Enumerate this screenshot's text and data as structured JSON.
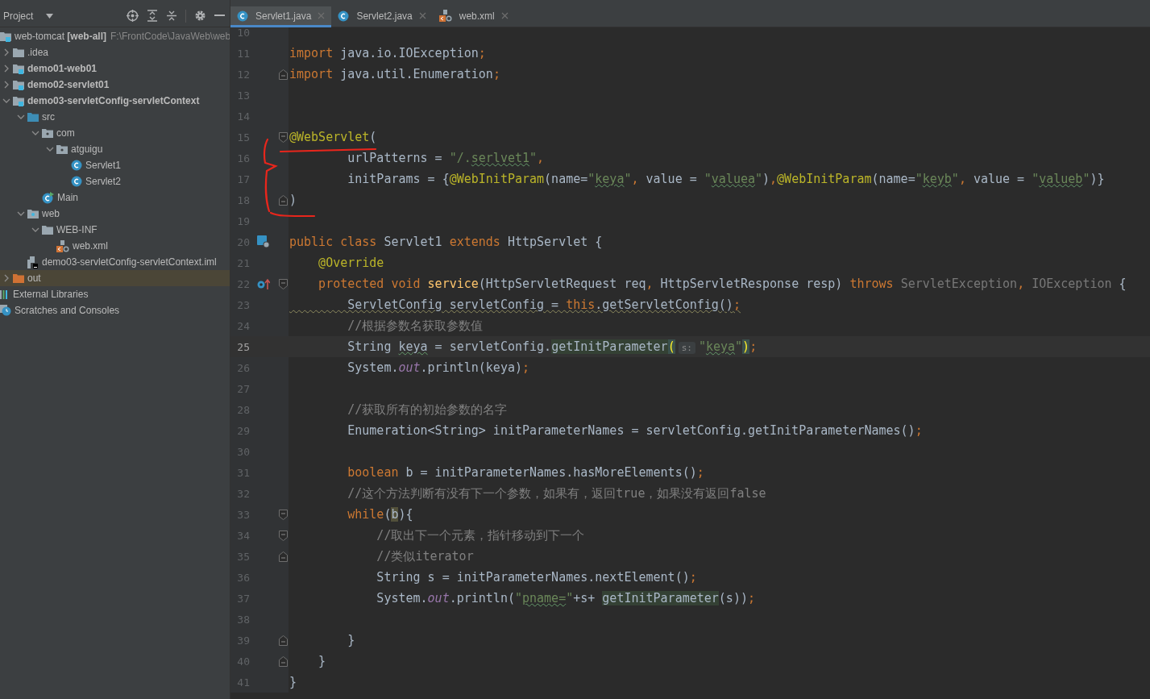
{
  "sidebar": {
    "title": "Project",
    "tree": [
      {
        "label": "web-tomcat **[web-all]**",
        "path": "F:\\FrontCode\\JavaWeb\\web",
        "kind": "project",
        "selected": false,
        "children": [
          {
            "label": ".idea",
            "kind": "folder",
            "expanded": false,
            "selected": false
          },
          {
            "label": "demo01-web01",
            "kind": "module",
            "expanded": false,
            "selected": false
          },
          {
            "label": "demo02-servlet01",
            "kind": "module",
            "expanded": false,
            "selected": false
          },
          {
            "label": "demo03-servletConfig-servletContext",
            "kind": "module",
            "expanded": true,
            "selected": false,
            "children": [
              {
                "label": "src",
                "kind": "source",
                "expanded": true,
                "selected": false,
                "children": [
                  {
                    "label": "com",
                    "kind": "package",
                    "expanded": true,
                    "selected": false,
                    "children": [
                      {
                        "label": "atguigu",
                        "kind": "package",
                        "expanded": true,
                        "selected": false,
                        "children": [
                          {
                            "label": "Servlet1",
                            "kind": "class",
                            "selected": false
                          },
                          {
                            "label": "Servlet2",
                            "kind": "class",
                            "selected": false
                          }
                        ]
                      }
                    ]
                  },
                  {
                    "label": "Main",
                    "kind": "main",
                    "selected": false
                  }
                ]
              },
              {
                "label": "web",
                "kind": "web",
                "expanded": true,
                "selected": false,
                "children": [
                  {
                    "label": "WEB-INF",
                    "kind": "folder",
                    "expanded": true,
                    "selected": false,
                    "children": [
                      {
                        "label": "web.xml",
                        "kind": "xml",
                        "selected": false
                      }
                    ]
                  }
                ]
              },
              {
                "label": "demo03-servletConfig-servletContext.iml",
                "kind": "iml",
                "selected": false
              }
            ]
          },
          {
            "label": "out",
            "kind": "excluded",
            "expanded": false,
            "selected": true
          }
        ]
      },
      {
        "label": "External Libraries",
        "kind": "libraries",
        "selected": false
      },
      {
        "label": "Scratches and Consoles",
        "kind": "scratches",
        "selected": false
      }
    ]
  },
  "tabs": [
    {
      "label": "Servlet1.java",
      "kind": "class",
      "selected": true
    },
    {
      "label": "Servlet2.java",
      "kind": "class",
      "selected": false
    },
    {
      "label": "web.xml",
      "kind": "xml",
      "selected": false
    }
  ],
  "editor": {
    "lines": [
      {
        "number": "10",
        "current": false
      },
      {
        "number": "11",
        "current": false,
        "tokens": [
          {
            "t": "import",
            "kind": "kw"
          },
          {
            "t": " java.io.IOException",
            "kind": "plain"
          },
          {
            "t": ";",
            "kind": "kw"
          }
        ]
      },
      {
        "number": "12",
        "current": false,
        "fold_end": true,
        "tokens": [
          {
            "t": "import",
            "kind": "kw"
          },
          {
            "t": " java.util.Enumeration",
            "kind": "plain"
          },
          {
            "t": ";",
            "kind": "kw"
          }
        ]
      },
      {
        "number": "13",
        "current": false
      },
      {
        "number": "14",
        "current": false
      },
      {
        "number": "15",
        "current": false,
        "fold_start": true,
        "tokens": [
          {
            "t": "@WebServlet",
            "kind": "ann"
          },
          {
            "t": "(",
            "kind": "plain"
          }
        ]
      },
      {
        "number": "16",
        "current": false,
        "tokens": [
          {
            "t": "        urlPatterns = ",
            "kind": "plain"
          },
          {
            "t": "\"/.",
            "kind": "str"
          },
          {
            "t": "serlvet1",
            "kind": "str",
            "typo": true
          },
          {
            "t": "\"",
            "kind": "str"
          },
          {
            "t": ",",
            "kind": "kw"
          }
        ]
      },
      {
        "number": "17",
        "current": false,
        "tokens": [
          {
            "t": "        initParams = {",
            "kind": "plain"
          },
          {
            "t": "@WebInitParam",
            "kind": "ann"
          },
          {
            "t": "(name=",
            "kind": "plain"
          },
          {
            "t": "\"",
            "kind": "str"
          },
          {
            "t": "keya",
            "kind": "str",
            "typo": true
          },
          {
            "t": "\"",
            "kind": "str"
          },
          {
            "t": ",",
            "kind": "kw"
          },
          {
            "t": " value = ",
            "kind": "plain"
          },
          {
            "t": "\"",
            "kind": "str"
          },
          {
            "t": "valuea",
            "kind": "str",
            "typo": true
          },
          {
            "t": "\"",
            "kind": "str"
          },
          {
            "t": ")",
            "kind": "plain"
          },
          {
            "t": ",",
            "kind": "kw"
          },
          {
            "t": "@WebInitParam",
            "kind": "ann"
          },
          {
            "t": "(name=",
            "kind": "plain"
          },
          {
            "t": "\"",
            "kind": "str"
          },
          {
            "t": "keyb",
            "kind": "str",
            "typo": true
          },
          {
            "t": "\"",
            "kind": "str"
          },
          {
            "t": ",",
            "kind": "kw"
          },
          {
            "t": " value = ",
            "kind": "plain"
          },
          {
            "t": "\"",
            "kind": "str"
          },
          {
            "t": "valueb",
            "kind": "str",
            "typo": true
          },
          {
            "t": "\"",
            "kind": "str"
          },
          {
            "t": ")}",
            "kind": "plain"
          }
        ]
      },
      {
        "number": "18",
        "current": false,
        "fold_end": true,
        "tokens": [
          {
            "t": ")",
            "kind": "plain"
          }
        ]
      },
      {
        "number": "19",
        "current": false
      },
      {
        "number": "20",
        "current": false,
        "gutter_icon": {
          "kind": "servlet"
        },
        "tokens": [
          {
            "t": "public class ",
            "kind": "kw"
          },
          {
            "t": "Servlet1 ",
            "kind": "plain"
          },
          {
            "t": "extends ",
            "kind": "kw"
          },
          {
            "t": "HttpServlet {",
            "kind": "plain"
          }
        ]
      },
      {
        "number": "21",
        "current": false,
        "tokens": [
          {
            "t": "    @Override",
            "kind": "ann"
          }
        ]
      },
      {
        "number": "22",
        "current": false,
        "gutter_icon": {
          "kind": "override"
        },
        "fold_start": true,
        "tokens": [
          {
            "t": "    protected void ",
            "kind": "kw"
          },
          {
            "t": "service",
            "kind": "decl"
          },
          {
            "t": "(HttpServletRequest req",
            "kind": "plain"
          },
          {
            "t": ",",
            "kind": "kw"
          },
          {
            "t": " HttpServletResponse resp) ",
            "kind": "plain"
          },
          {
            "t": "throws ",
            "kind": "kw"
          },
          {
            "t": "ServletException",
            "kind": "unused"
          },
          {
            "t": ",",
            "kind": "kw"
          },
          {
            "t": " IOException",
            "kind": "unused"
          },
          {
            "t": " {",
            "kind": "plain"
          }
        ]
      },
      {
        "number": "23",
        "current": false,
        "tokens": [
          {
            "t": "        ServletConfig servletConfig = ",
            "kind": "plain",
            "warning": true
          },
          {
            "t": "this",
            "kind": "kw",
            "warning": true
          },
          {
            "t": ".getServletConfig()",
            "kind": "plain",
            "warning": true
          },
          {
            "t": ";",
            "kind": "kw",
            "warning": true
          }
        ]
      },
      {
        "number": "24",
        "current": false,
        "tokens": [
          {
            "t": "        //根据参数名获取参数值",
            "kind": "cmt"
          }
        ]
      },
      {
        "number": "25",
        "current": true,
        "tokens": [
          {
            "t": "        String ",
            "kind": "plain"
          },
          {
            "t": "keya",
            "kind": "plain",
            "typo": true
          },
          {
            "t": " = servletConfig.",
            "kind": "plain"
          },
          {
            "t": "getInitParameter",
            "kind": "hl"
          },
          {
            "t": "(",
            "kind": "match"
          },
          {
            "t": "s:",
            "kind": "hint"
          },
          {
            "t": "\"",
            "kind": "str"
          },
          {
            "t": "keya",
            "kind": "str",
            "typo": true
          },
          {
            "t": "\"",
            "kind": "str"
          },
          {
            "t": ")",
            "kind": "match"
          },
          {
            "t": ";",
            "kind": "kw"
          }
        ]
      },
      {
        "number": "26",
        "current": false,
        "tokens": [
          {
            "t": "        System.",
            "kind": "plain"
          },
          {
            "t": "out",
            "kind": "static"
          },
          {
            "t": ".println(keya)",
            "kind": "plain"
          },
          {
            "t": ";",
            "kind": "kw"
          }
        ]
      },
      {
        "number": "27",
        "current": false
      },
      {
        "number": "28",
        "current": false,
        "tokens": [
          {
            "t": "        //获取所有的初始参数的名字",
            "kind": "cmt"
          }
        ]
      },
      {
        "number": "29",
        "current": false,
        "tokens": [
          {
            "t": "        Enumeration<String> initParameterNames = servletConfig.getInitParameterNames()",
            "kind": "plain"
          },
          {
            "t": ";",
            "kind": "kw"
          }
        ]
      },
      {
        "number": "30",
        "current": false
      },
      {
        "number": "31",
        "current": false,
        "tokens": [
          {
            "t": "        boolean ",
            "kind": "kw"
          },
          {
            "t": "b = initParameterNames.hasMoreElements()",
            "kind": "plain"
          },
          {
            "t": ";",
            "kind": "kw"
          }
        ]
      },
      {
        "number": "32",
        "current": false,
        "tokens": [
          {
            "t": "        //这个方法判断有没有下一个参数，如果有，返回true，如果没有返回false",
            "kind": "cmt"
          }
        ]
      },
      {
        "number": "33",
        "current": false,
        "fold_start": true,
        "tokens": [
          {
            "t": "        while",
            "kind": "kw"
          },
          {
            "t": "(",
            "kind": "plain"
          },
          {
            "t": "b",
            "kind": "usage"
          },
          {
            "t": "){",
            "kind": "plain"
          }
        ]
      },
      {
        "number": "34",
        "current": false,
        "fold_start": true,
        "tokens": [
          {
            "t": "            //取出下一个元素，指针移动到下一个",
            "kind": "cmt"
          }
        ]
      },
      {
        "number": "35",
        "current": false,
        "fold_end": true,
        "tokens": [
          {
            "t": "            //类似iterator",
            "kind": "cmt"
          }
        ]
      },
      {
        "number": "36",
        "current": false,
        "tokens": [
          {
            "t": "            String s = initParameterNames.nextElement()",
            "kind": "plain"
          },
          {
            "t": ";",
            "kind": "kw"
          }
        ]
      },
      {
        "number": "37",
        "current": false,
        "tokens": [
          {
            "t": "            System.",
            "kind": "plain"
          },
          {
            "t": "out",
            "kind": "static"
          },
          {
            "t": ".println(",
            "kind": "plain"
          },
          {
            "t": "\"",
            "kind": "str"
          },
          {
            "t": "pname=",
            "kind": "str",
            "typo": true
          },
          {
            "t": "\"",
            "kind": "str"
          },
          {
            "t": "+s+ ",
            "kind": "plain"
          },
          {
            "t": "getInitParameter",
            "kind": "hl"
          },
          {
            "t": "(s))",
            "kind": "plain"
          },
          {
            "t": ";",
            "kind": "kw"
          }
        ]
      },
      {
        "number": "38",
        "current": false
      },
      {
        "number": "39",
        "current": false,
        "fold_end": true,
        "tokens": [
          {
            "t": "        }",
            "kind": "plain"
          }
        ]
      },
      {
        "number": "40",
        "current": false,
        "fold_end": true,
        "tokens": [
          {
            "t": "    }",
            "kind": "plain"
          }
        ]
      },
      {
        "number": "41",
        "current": false,
        "tokens": [
          {
            "t": "}",
            "kind": "plain"
          }
        ]
      }
    ]
  }
}
